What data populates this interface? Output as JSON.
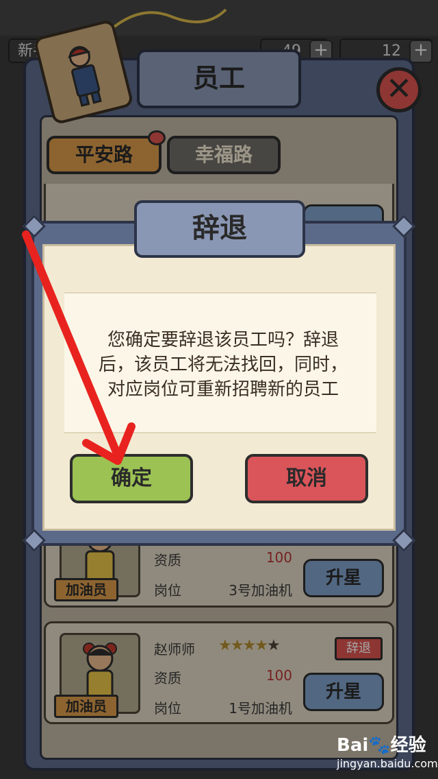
{
  "topbar": {
    "left_label": "新手",
    "counter_a": "49",
    "counter_b": "12",
    "plus_symbol": "+"
  },
  "employee_panel": {
    "title": "员工",
    "close_symbol": "✕",
    "tabs": [
      {
        "label": "平安路",
        "active": true
      },
      {
        "label": "幸福路",
        "active": false
      }
    ]
  },
  "employees": [
    {
      "role": "加油员",
      "quality_label": "资质",
      "quality_value": "100",
      "post_label": "岗位",
      "post_value": "3号加油机",
      "upgrade_label": "升星"
    },
    {
      "name": "赵师师",
      "stars_filled": 4,
      "stars_total": 5,
      "dismiss_label": "辞退",
      "role": "加油员",
      "quality_label": "资质",
      "quality_value": "100",
      "post_label": "岗位",
      "post_value": "1号加油机",
      "upgrade_label": "升星"
    }
  ],
  "dialog": {
    "title": "辞退",
    "message_lines": [
      "您确定要辞退该员工吗？辞退",
      "后，该员工将无法找回，同时，",
      "对应岗位可重新招聘新的员工"
    ],
    "confirm_label": "确定",
    "cancel_label": "取消"
  },
  "watermark": {
    "logo": "Bai🐾经验",
    "url": "jingyan.baidu.com"
  },
  "colors": {
    "panel": "#5c6a8a",
    "paper": "#f3ead4",
    "confirm": "#9cc254",
    "cancel": "#d9555a",
    "annotation_arrow": "#e8231f"
  }
}
